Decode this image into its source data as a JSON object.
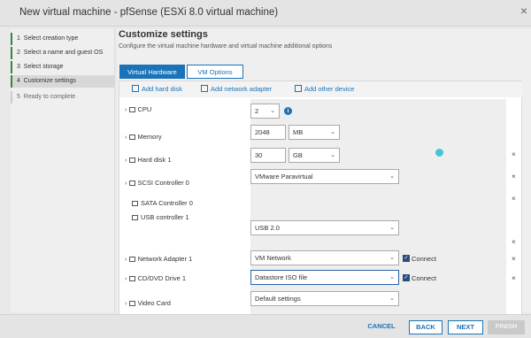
{
  "window": {
    "title": "New virtual machine - pfSense (ESXi 8.0 virtual machine)",
    "close": "×"
  },
  "steps": [
    {
      "num": "1",
      "label": "Select creation type"
    },
    {
      "num": "2",
      "label": "Select a name and guest OS"
    },
    {
      "num": "3",
      "label": "Select storage"
    },
    {
      "num": "4",
      "label": "Customize settings"
    },
    {
      "num": "5",
      "label": "Ready to complete"
    }
  ],
  "page": {
    "heading": "Customize settings",
    "subheading": "Configure the virtual machine hardware and virtual machine additional options"
  },
  "tabs": [
    {
      "label": "Virtual Hardware"
    },
    {
      "label": "VM Options"
    }
  ],
  "actions": [
    {
      "label": "Add hard disk"
    },
    {
      "label": "Add network adapter"
    },
    {
      "label": "Add other device"
    }
  ],
  "hardware": {
    "cpu": {
      "label": "CPU",
      "value": "2",
      "info": "i"
    },
    "memory": {
      "label": "Memory",
      "value": "2048",
      "unit": "MB"
    },
    "hard_disk": {
      "label": "Hard disk 1",
      "value": "30",
      "unit": "GB"
    },
    "scsi": {
      "label": "SCSI Controller 0",
      "value": "VMware Paravirtual"
    },
    "sata": {
      "label": "SATA Controller 0"
    },
    "usb": {
      "label": "USB controller 1",
      "value": "USB 2.0"
    },
    "network": {
      "label": "Network Adapter 1",
      "value": "VM Network",
      "connect": "Connect"
    },
    "cddvd": {
      "label": "CD/DVD Drive 1",
      "value": "Datastore ISO file",
      "connect": "Connect"
    },
    "video": {
      "label": "Video Card",
      "value": "Default settings"
    }
  },
  "remove_glyph": "×",
  "caret": "⌄",
  "chevron": "›",
  "check": "✓",
  "footer": {
    "cancel": "CANCEL",
    "back": "BACK",
    "next": "NEXT",
    "finish": "FINISH"
  },
  "colors": {
    "accent": "#1a73b8",
    "step_done": "#2e8b3c",
    "disabled": "#c9c9c9"
  }
}
